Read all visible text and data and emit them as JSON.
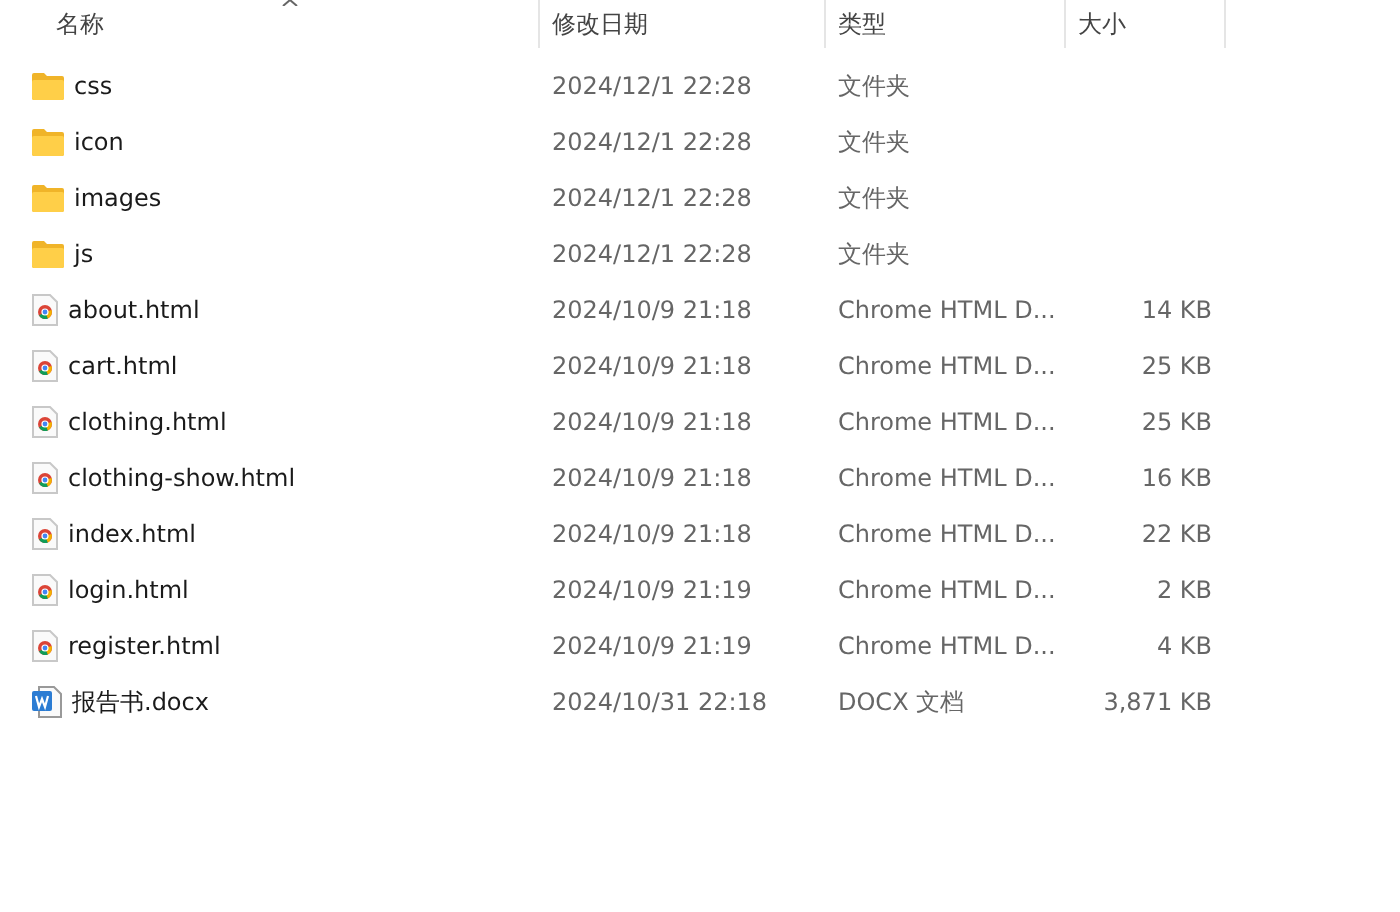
{
  "columns": [
    "名称",
    "修改日期",
    "类型",
    "大小"
  ],
  "files": [
    {
      "kind": "folder",
      "name": "css",
      "modified": "2024/12/1 22:28",
      "type": "文件夹"
    },
    {
      "kind": "folder",
      "name": "icon",
      "modified": "2024/12/1 22:28",
      "type": "文件夹"
    },
    {
      "kind": "folder",
      "name": "images",
      "modified": "2024/12/1 22:28",
      "type": "文件夹"
    },
    {
      "kind": "folder",
      "name": "js",
      "modified": "2024/12/1 22:28",
      "type": "文件夹"
    },
    {
      "kind": "html",
      "name": "about.html",
      "modified": "2024/10/9 21:18",
      "type": "Chrome HTML D...",
      "size": "14 KB"
    },
    {
      "kind": "html",
      "name": "cart.html",
      "modified": "2024/10/9 21:18",
      "type": "Chrome HTML D...",
      "size": "25 KB"
    },
    {
      "kind": "html",
      "name": "clothing.html",
      "modified": "2024/10/9 21:18",
      "type": "Chrome HTML D...",
      "size": "25 KB"
    },
    {
      "kind": "html",
      "name": "clothing-show.html",
      "modified": "2024/10/9 21:18",
      "type": "Chrome HTML D...",
      "size": "16 KB"
    },
    {
      "kind": "html",
      "name": "index.html",
      "modified": "2024/10/9 21:18",
      "type": "Chrome HTML D...",
      "size": "22 KB"
    },
    {
      "kind": "html",
      "name": "login.html",
      "modified": "2024/10/9 21:19",
      "type": "Chrome HTML D...",
      "size": "2 KB"
    },
    {
      "kind": "html",
      "name": "register.html",
      "modified": "2024/10/9 21:19",
      "type": "Chrome HTML D...",
      "size": "4 KB"
    },
    {
      "kind": "docx",
      "name": "报告书.docx",
      "modified": "2024/10/31 22:18",
      "type": "DOCX 文档",
      "size": "3,871 KB"
    }
  ]
}
